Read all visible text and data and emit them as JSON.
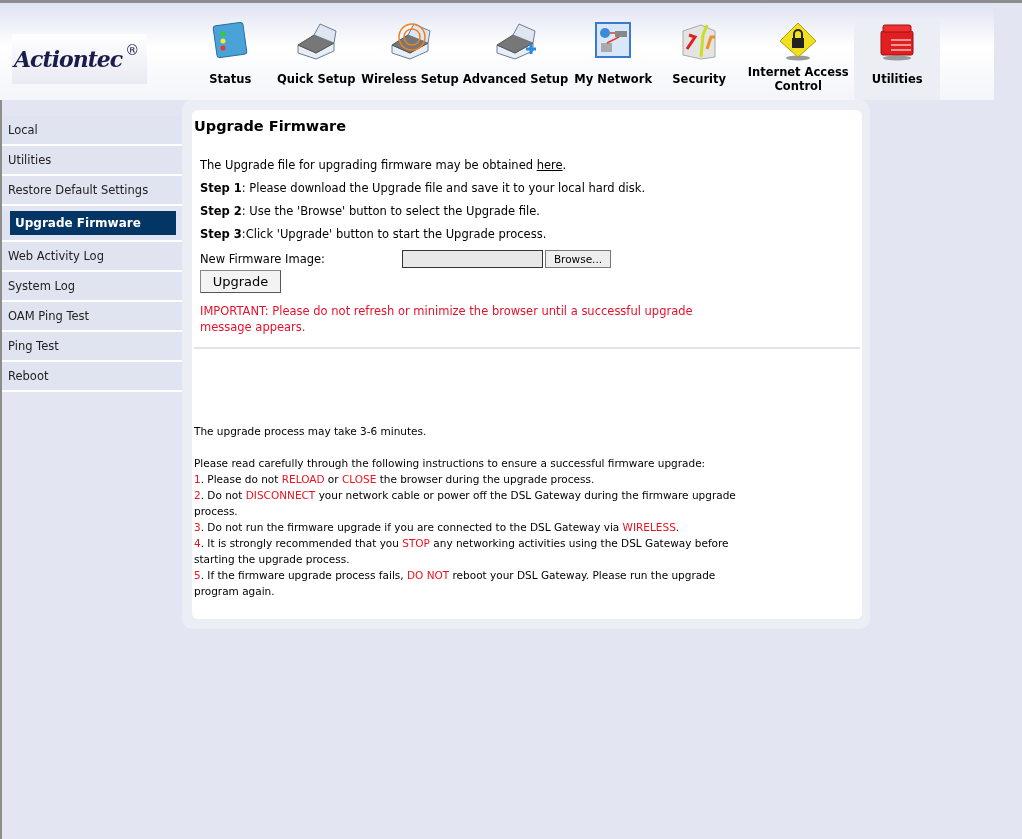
{
  "logo": {
    "text": "Actiontec",
    "mark": "®"
  },
  "nav": [
    {
      "label": "Status",
      "kind": "status",
      "selected": false
    },
    {
      "label": "Quick Setup",
      "kind": "quick",
      "selected": false
    },
    {
      "label": "Wireless Setup",
      "kind": "wireless",
      "selected": false
    },
    {
      "label": "Advanced Setup",
      "kind": "advanced",
      "selected": false
    },
    {
      "label": "My Network",
      "kind": "network",
      "selected": false
    },
    {
      "label": "Security",
      "kind": "security",
      "selected": false
    },
    {
      "label": "Internet Access Control",
      "kind": "lock",
      "selected": false
    },
    {
      "label": "Utilities",
      "kind": "toolbox",
      "selected": true
    }
  ],
  "sidebar": {
    "items": [
      {
        "label": "Local",
        "selected": false
      },
      {
        "label": "Utilities",
        "selected": false
      },
      {
        "label": "Restore Default Settings",
        "selected": false
      },
      {
        "label": "Upgrade Firmware",
        "selected": true
      },
      {
        "label": "Web Activity Log",
        "selected": false
      },
      {
        "label": "System Log",
        "selected": false
      },
      {
        "label": "OAM Ping Test",
        "selected": false
      },
      {
        "label": "Ping Test",
        "selected": false
      },
      {
        "label": "Reboot",
        "selected": false
      }
    ]
  },
  "content": {
    "title": "Upgrade Firmware",
    "intro": "The Upgrade file for upgrading firmware may be obtained ",
    "intro_link": "here",
    "intro_end": ".",
    "steps": [
      {
        "text": "**Step 1**: Please download the Upgrade file and save it to your local hard disk."
      },
      {
        "text": "**Step 2**: Use the 'Browse' button to select the Upgrade file."
      },
      {
        "text": "**Step 3**:Click 'Upgrade' button to start the Upgrade process."
      }
    ],
    "file_label": "New Firmware Image:",
    "browse_button": "Browse...",
    "upgrade_button": "Upgrade",
    "warning": "IMPORTANT: Please do not refresh or minimize the browser until a successful upgrade message appears.",
    "duration_note": "The upgrade process may take 3-6 minutes.",
    "instructions_intro": "Please read carefully through the following instructions to ensure a successful firmware upgrade:",
    "instructions": [
      {
        "number": "1",
        "parts": [
          {
            "text": ". Please do not ",
            "emphasis": false
          },
          {
            "text": "RELOAD",
            "emphasis": true
          },
          {
            "text": " or ",
            "emphasis": false
          },
          {
            "text": "CLOSE",
            "emphasis": true
          },
          {
            "text": " the browser during the upgrade process.",
            "emphasis": false
          }
        ]
      },
      {
        "number": "2",
        "parts": [
          {
            "text": ". Do not ",
            "emphasis": false
          },
          {
            "text": "DISCONNECT",
            "emphasis": true
          },
          {
            "text": " your network cable or power off the DSL Gateway during the firmware upgrade process.",
            "emphasis": false
          }
        ]
      },
      {
        "number": "3",
        "parts": [
          {
            "text": ". Do not run the firmware upgrade if you are connected to the DSL Gateway via ",
            "emphasis": false
          },
          {
            "text": "WIRELESS",
            "emphasis": true
          },
          {
            "text": ".",
            "emphasis": false
          }
        ]
      },
      {
        "number": "4",
        "parts": [
          {
            "text": ". It is strongly recommended that you ",
            "emphasis": false
          },
          {
            "text": "STOP",
            "emphasis": true
          },
          {
            "text": " any networking activities using the DSL Gateway before starting the upgrade process.",
            "emphasis": false
          }
        ]
      },
      {
        "number": "5",
        "parts": [
          {
            "text": ". If the firmware upgrade process fails, ",
            "emphasis": false
          },
          {
            "text": "DO NOT",
            "emphasis": true
          },
          {
            "text": " reboot your DSL Gateway. Please run the upgrade program again.",
            "emphasis": false
          }
        ]
      }
    ]
  }
}
